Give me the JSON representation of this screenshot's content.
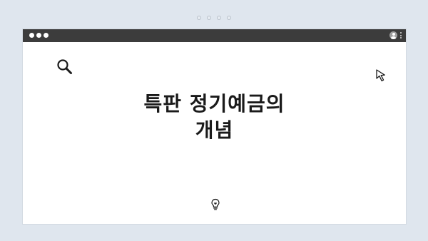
{
  "pager": {
    "count": 4,
    "active_index": -1
  },
  "window": {
    "titlebar": {
      "controls": [
        "dot",
        "dot",
        "dot"
      ],
      "right_icons": [
        "user-icon",
        "kebab-menu-icon"
      ]
    }
  },
  "content": {
    "headline_line1": "특판 정기예금의",
    "headline_line2": "개념",
    "icons": [
      "search-icon",
      "cursor-icon",
      "lightbulb-icon"
    ]
  },
  "colors": {
    "background": "#dfe6ee",
    "titlebar": "#3c3c3c",
    "window": "#ffffff",
    "headline": "#1a1a1a"
  }
}
